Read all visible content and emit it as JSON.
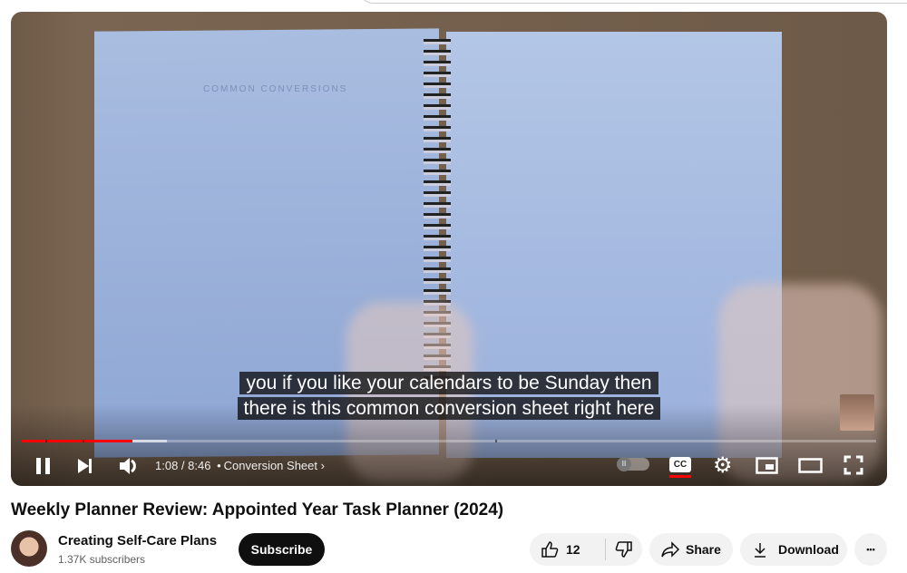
{
  "video": {
    "page_heading": "COMMON CONVERSIONS",
    "captions": [
      "you if you like your calendars to be Sunday then",
      "there is this common conversion sheet right here"
    ],
    "progress": {
      "current": "1:08",
      "duration": "8:46",
      "played_fraction": 0.13,
      "buffered_fraction": 0.17,
      "separator": " / "
    },
    "chapter": "Conversion Sheet",
    "chapter_dot": "•",
    "controls": {
      "cc_label": "CC",
      "autoplay": "off"
    }
  },
  "title": "Weekly Planner Review: Appointed Year Task Planner (2024)",
  "channel": {
    "name": "Creating Self-Care Plans",
    "subscribers": "1.37K subscribers",
    "subscribe_label": "Subscribe"
  },
  "actions": {
    "likes": "12",
    "share": "Share",
    "download": "Download"
  },
  "colors": {
    "accent": "#ff0000",
    "subscribe_bg": "#0f0f0f",
    "pill_bg": "#f2f2f2"
  }
}
